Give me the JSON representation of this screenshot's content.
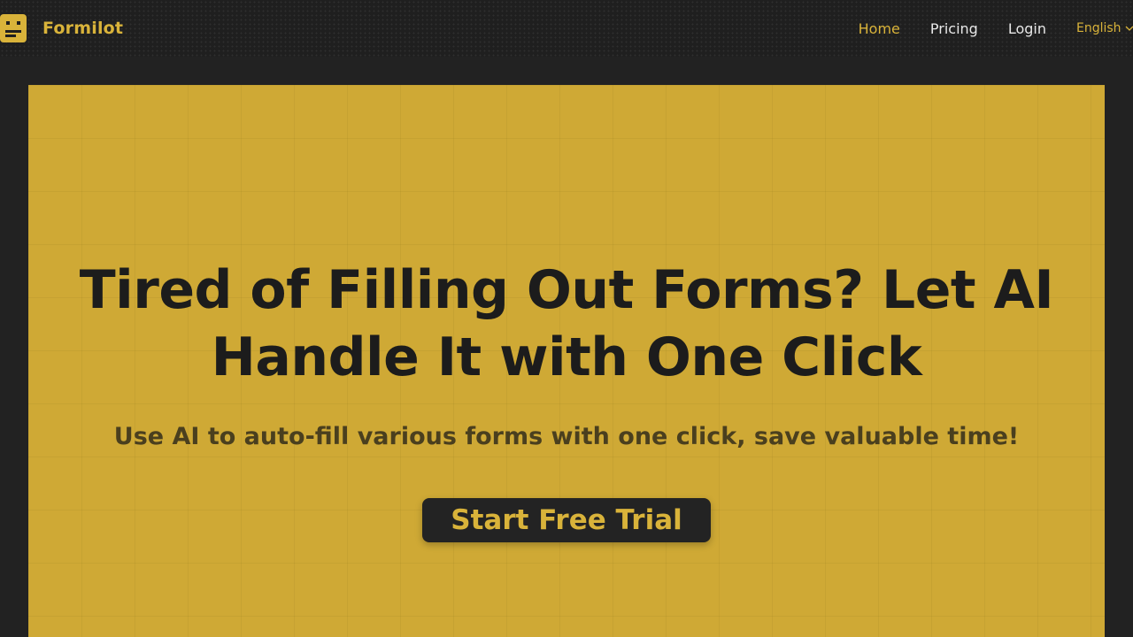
{
  "header": {
    "brand": "Formilot",
    "nav": [
      {
        "label": "Home",
        "active": true
      },
      {
        "label": "Pricing",
        "active": false
      },
      {
        "label": "Login",
        "active": false
      }
    ],
    "language": "English"
  },
  "hero": {
    "headline_line1": "Tired of Filling Out Forms? Let AI",
    "headline_line2": "Handle It with One Click",
    "subheadline": "Use AI to auto-fill various forms with one click, save valuable time!",
    "cta_label": "Start Free Trial"
  },
  "colors": {
    "accent": "#d9b33a",
    "hero_bg": "#cfa935",
    "dark": "#1f1f1f"
  },
  "icons": {
    "logo": "form-face-icon",
    "language_caret": "chevron-down-icon"
  }
}
